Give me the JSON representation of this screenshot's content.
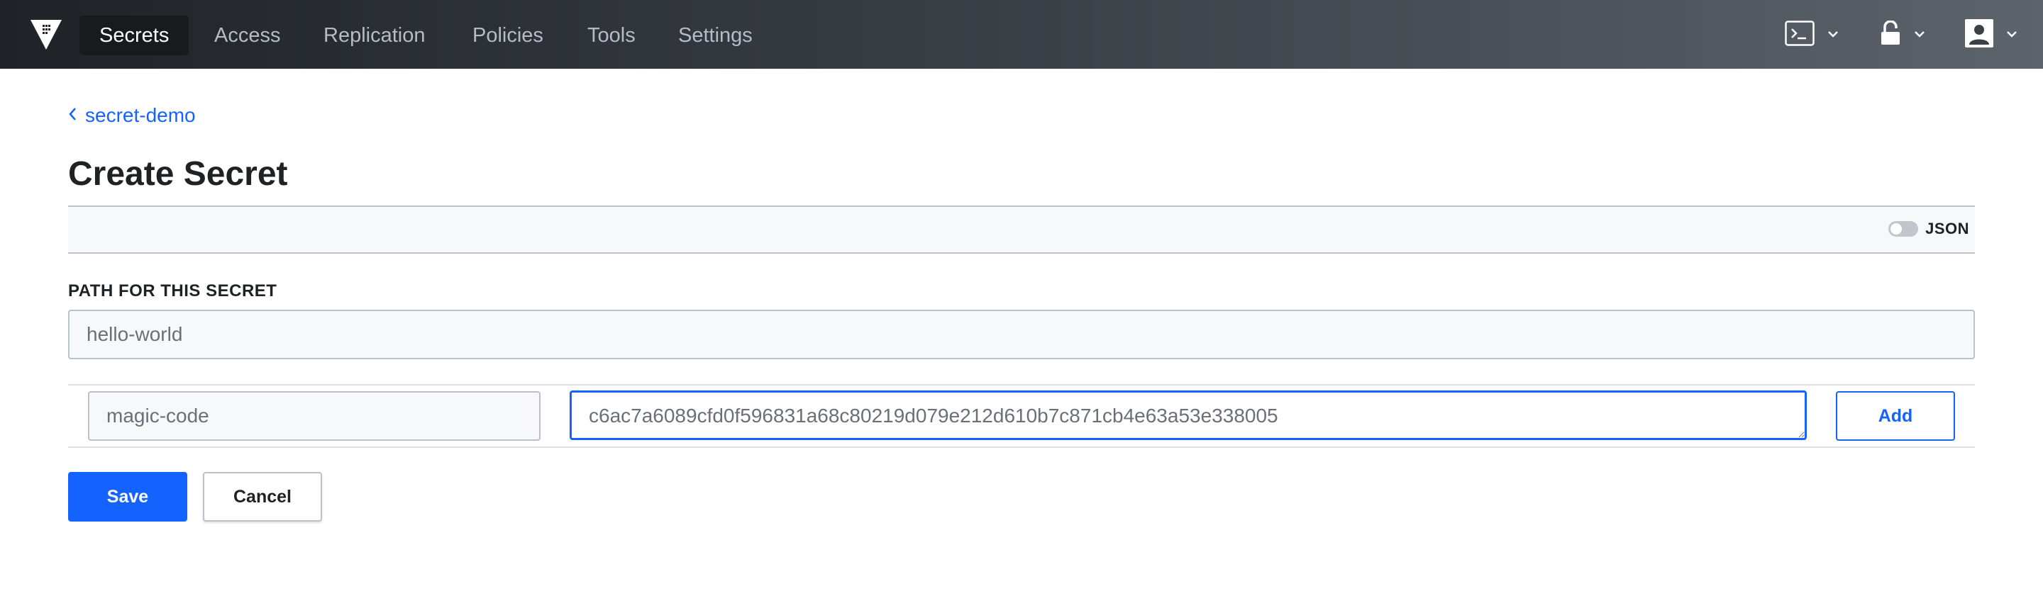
{
  "nav": {
    "items": [
      {
        "label": "Secrets",
        "active": true
      },
      {
        "label": "Access",
        "active": false
      },
      {
        "label": "Replication",
        "active": false
      },
      {
        "label": "Policies",
        "active": false
      },
      {
        "label": "Tools",
        "active": false
      },
      {
        "label": "Settings",
        "active": false
      }
    ],
    "right": {
      "console_icon": "terminal-icon",
      "seal_icon": "unlocked-padlock-icon",
      "user_icon": "user-avatar-icon",
      "dropdown_icon": "chevron-down-icon"
    }
  },
  "breadcrumb": {
    "label": "secret-demo",
    "icon": "chevron-left-icon"
  },
  "page": {
    "title": "Create Secret"
  },
  "toolbar": {
    "json_toggle_label": "JSON",
    "json_enabled": false
  },
  "form": {
    "path_label": "PATH FOR THIS SECRET",
    "path_value": "hello-world",
    "kv": {
      "key_value": "magic-code",
      "value_value": "c6ac7a6089cfd0f596831a68c80219d079e212d610b7c871cb4e63a53e338005",
      "add_label": "Add"
    },
    "save_label": "Save",
    "cancel_label": "Cancel"
  },
  "colors": {
    "accent": "#1563ff",
    "nav_bg_start": "#1f2327",
    "nav_bg_end": "#5d636b",
    "nav_text": "#b6bcc4",
    "border": "#bac1cc"
  }
}
